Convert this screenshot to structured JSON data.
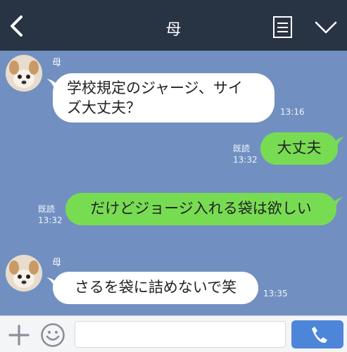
{
  "header": {
    "title": "母",
    "back_icon": "chevron-left-icon",
    "notes_icon": "note-icon",
    "menu_icon": "chevron-down-icon"
  },
  "messages": [
    {
      "direction": "in",
      "sender": "母",
      "text_lines": [
        "学校規定のジャージ、サイ",
        "ズ大丈夫？"
      ],
      "time": "13:16"
    },
    {
      "direction": "out",
      "read": "既読",
      "text": "大丈夫",
      "time": "13:32"
    },
    {
      "direction": "out",
      "read": "既読",
      "text": "だけどジョージ入れる袋は欲しい",
      "time": "13:32"
    },
    {
      "direction": "in",
      "sender": "母",
      "text": "さるを袋に詰めないで笑",
      "time": "13:35"
    }
  ],
  "input": {
    "value": "",
    "plus_icon": "plus-icon",
    "emoji_icon": "emoji-icon",
    "call_icon": "phone-icon"
  },
  "colors": {
    "header": "#283444",
    "chat_bg": "#7190c1",
    "incoming_bubble": "#ffffff",
    "outgoing_bubble": "#78dc52",
    "call_button": "#4d86d9"
  }
}
